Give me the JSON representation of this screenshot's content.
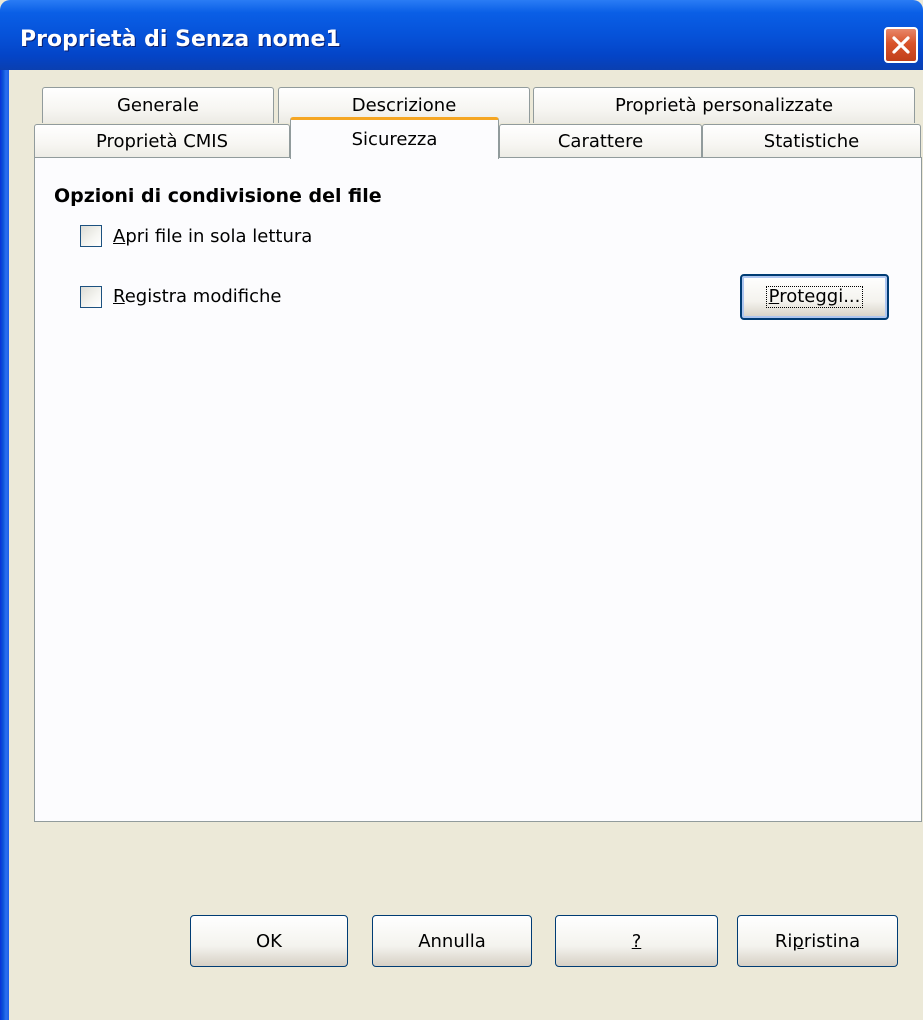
{
  "window": {
    "title": "Proprietà di Senza nome1",
    "close_icon": "close-icon"
  },
  "tabs": {
    "row1": [
      "Generale",
      "Descrizione",
      "Proprietà personalizzate"
    ],
    "row2": [
      "Proprietà CMIS",
      "Sicurezza",
      "Carattere",
      "Statistiche"
    ],
    "active": "Sicurezza"
  },
  "security": {
    "section_title": "Opzioni di condivisione del file",
    "readonly": {
      "mnemonic": "A",
      "rest": "pri file in sola lettura",
      "checked": false
    },
    "record_changes": {
      "mnemonic": "R",
      "rest": "egistra modifiche",
      "checked": false
    },
    "protect_button": {
      "mnemonic": "P",
      "rest": "roteggi..."
    }
  },
  "buttons": {
    "ok": "OK",
    "cancel": "Annulla",
    "help": "?",
    "reset_pre": "Ri",
    "reset_mnemonic": "p",
    "reset_post": "ristina"
  },
  "colors": {
    "active_tab_accent": "#f5a623",
    "title_bar": "#0652d9",
    "close_button": "#d9532a",
    "dialog_background": "#ece9d8"
  }
}
